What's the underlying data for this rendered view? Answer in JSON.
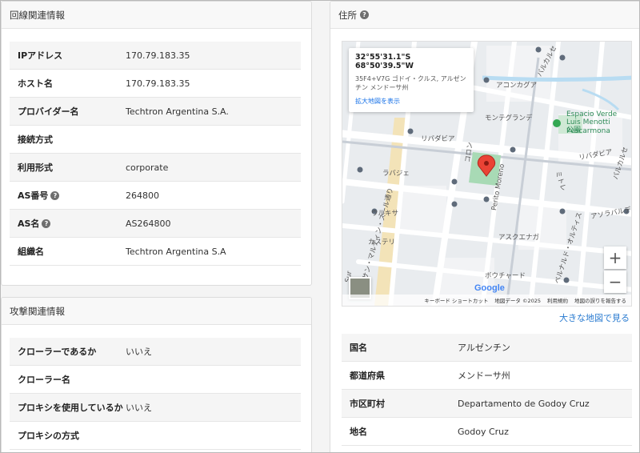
{
  "line_info": {
    "title": "回線関連情報",
    "rows": [
      {
        "label": "IPアドレス",
        "value": "170.79.183.35",
        "help": false
      },
      {
        "label": "ホスト名",
        "value": "170.79.183.35",
        "help": false
      },
      {
        "label": "プロバイダー名",
        "value": "Techtron Argentina S.A.",
        "help": false
      },
      {
        "label": "接続方式",
        "value": "",
        "help": false
      },
      {
        "label": "利用形式",
        "value": "corporate",
        "help": false
      },
      {
        "label": "AS番号",
        "value": "264800",
        "help": true
      },
      {
        "label": "AS名",
        "value": "AS264800",
        "help": true
      },
      {
        "label": "組織名",
        "value": "Techtron Argentina S.A",
        "help": false
      }
    ]
  },
  "attack_info": {
    "title": "攻撃関連情報",
    "rows": [
      {
        "label": "クローラーであるか",
        "value": "いいえ"
      },
      {
        "label": "クローラー名",
        "value": ""
      },
      {
        "label": "プロキシを使用しているか",
        "value": "いいえ"
      },
      {
        "label": "プロキシの方式",
        "value": ""
      }
    ]
  },
  "address": {
    "title": "住所",
    "help_glyph": "?",
    "map": {
      "coords": "32°55'31.1\"S 68°50'39.5\"W",
      "plus_code": "35F4+V7G ゴドイ・クルス, アルゼンチン メンドーサ州",
      "enlarge_link": "拡大地図を表示",
      "zoom_in": "+",
      "zoom_out": "−",
      "google": "Google",
      "footer": [
        "キーボード ショートカット",
        "地図データ ©2025",
        "利用規約",
        "地図の誤りを報告する"
      ],
      "labels": {
        "acongagua": "アコンカグア",
        "valcarce": "バルカルセ",
        "montegrande": "モンテグランデ",
        "rivadavia1": "リバダビア",
        "rivadavia2": "リバダビア",
        "espacio": "Espacio Verde Luis Menotti Pescarmona",
        "park": "公園",
        "colon": "コロン",
        "labajhe": "ラバジェ",
        "mitre": "ミトレ",
        "lavalle2": "ラバジェ",
        "perito": "Perito Moreno",
        "wurquiza": "ウルキサ",
        "sanmartin": "サン・マルティン・スール通り",
        "ayolas": "アソラバルデ",
        "castelli": "カステリ",
        "askuenaga": "アスクエナガ",
        "belgrano": "ベルナルド・オルティス",
        "bouchard": "ボウチャード",
        "sur": "Sur"
      }
    },
    "big_map_link": "大きな地図で見る",
    "rows": [
      {
        "label": "国名",
        "value": "アルゼンチン"
      },
      {
        "label": "都道府県",
        "value": "メンドーサ州"
      },
      {
        "label": "市区町村",
        "value": "Departamento de Godoy Cruz"
      },
      {
        "label": "地名",
        "value": "Godoy Cruz"
      }
    ]
  },
  "colors": {
    "link": "#2a7bd0",
    "park_green": "#a8dab5",
    "marker_red": "#ea4335"
  }
}
